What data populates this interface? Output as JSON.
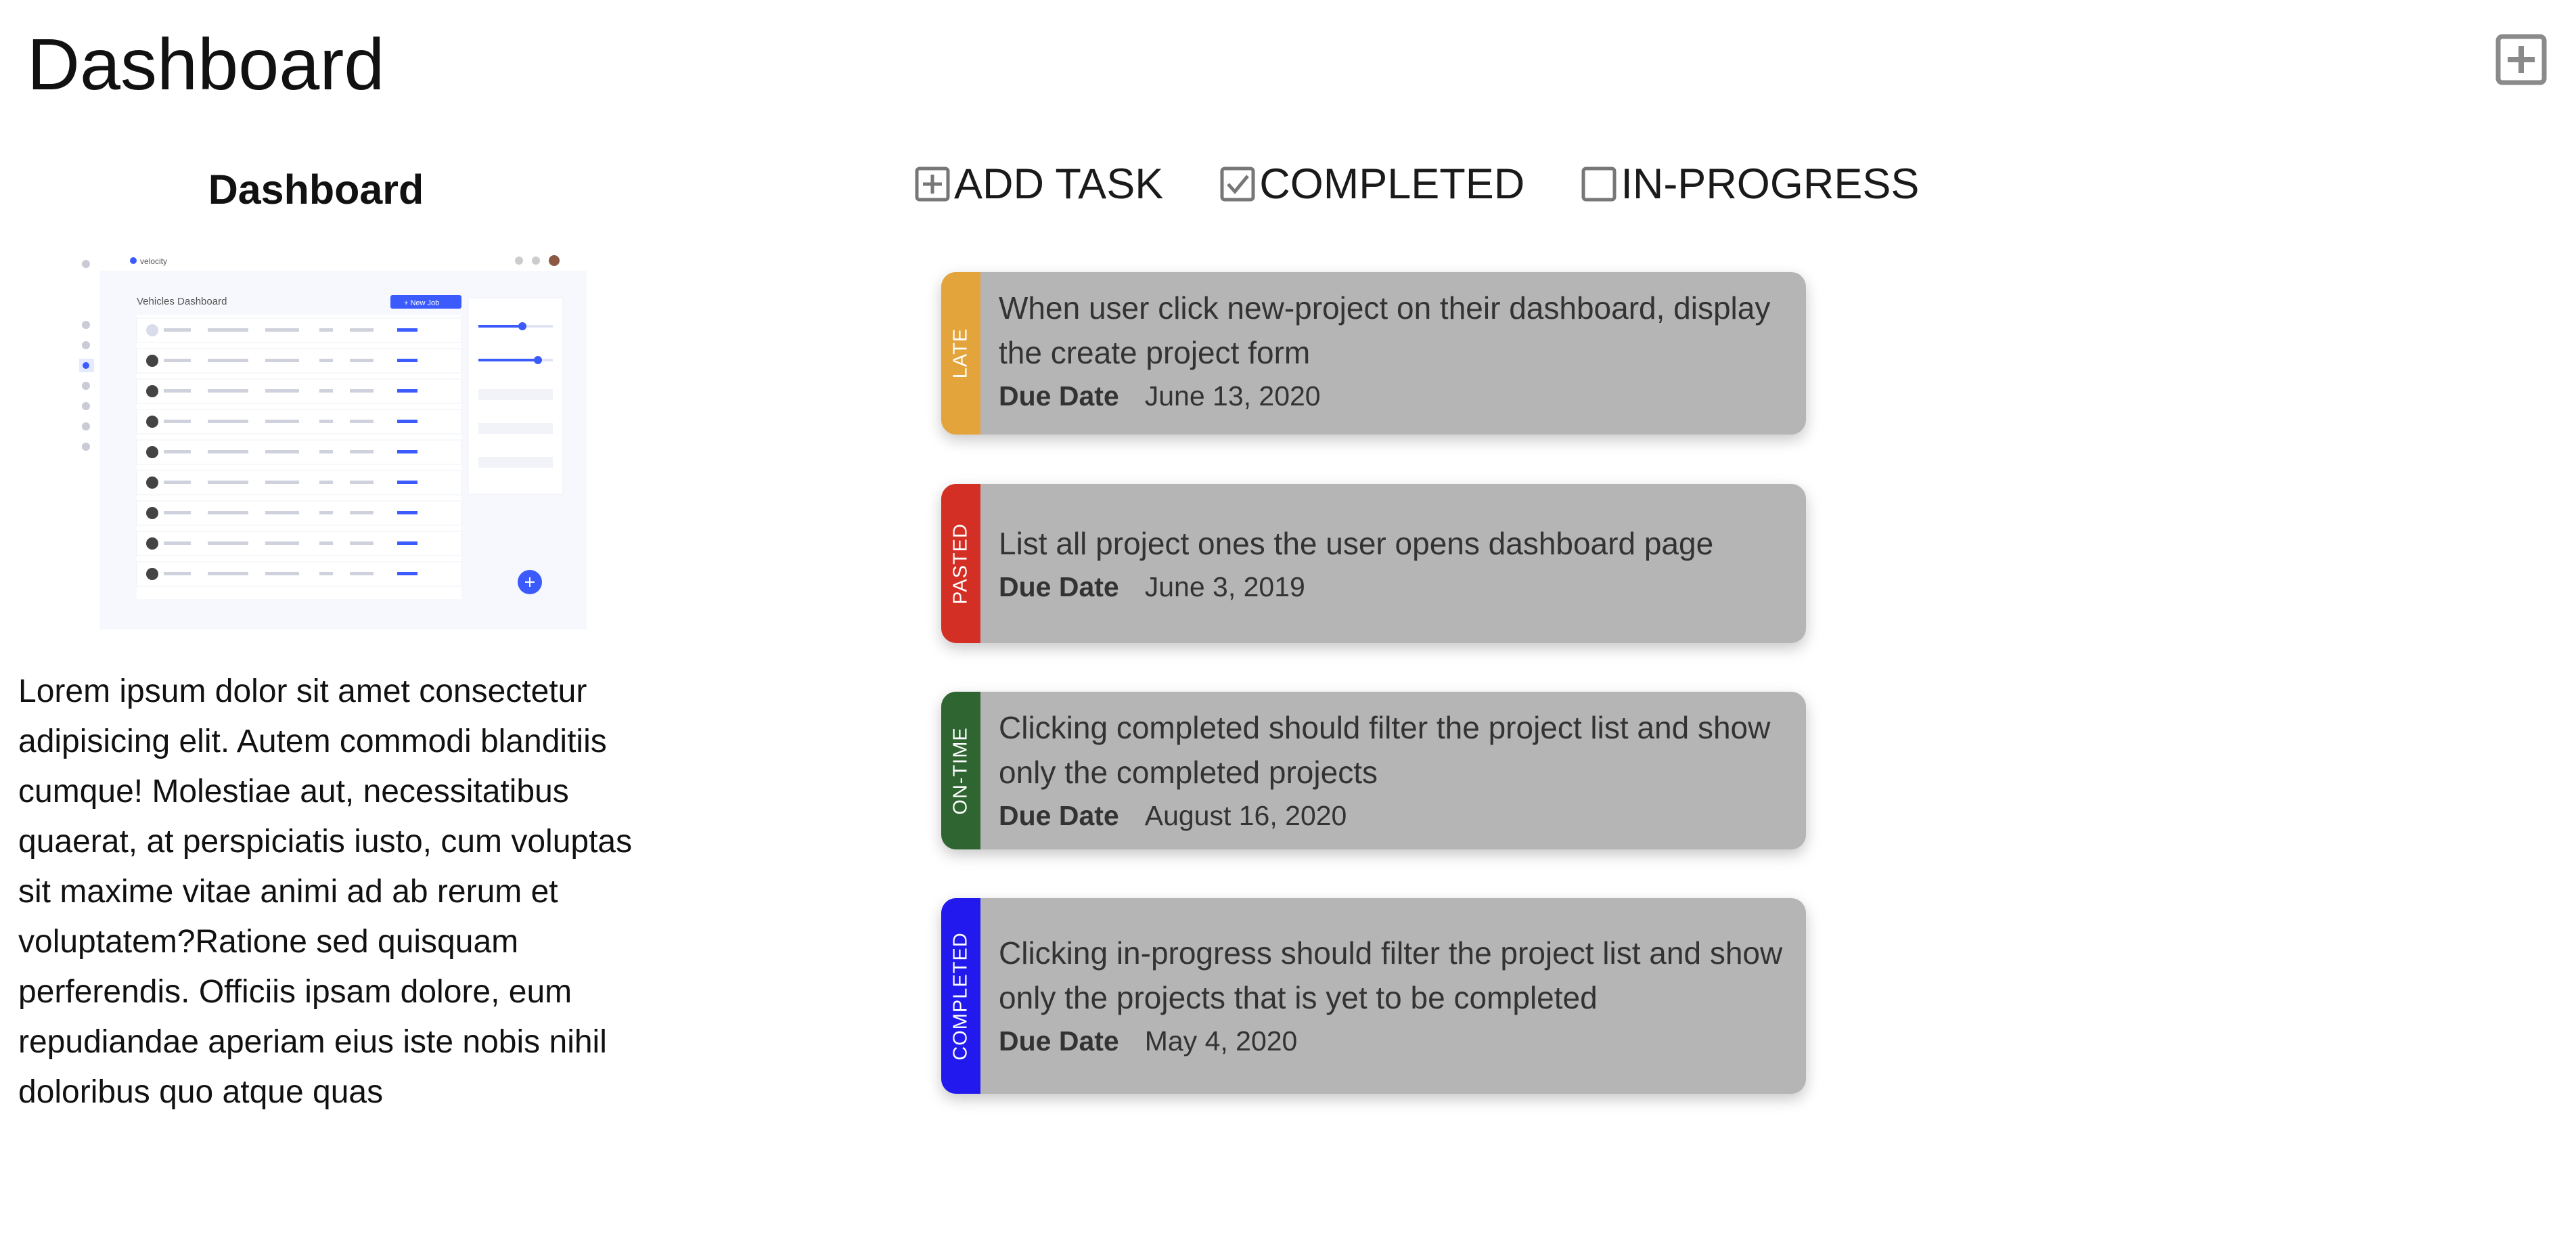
{
  "header": {
    "title": "Dashboard",
    "add_icon": "plus-square-icon"
  },
  "sidebar": {
    "preview_title": "Dashboard",
    "preview_image": {
      "app_name": "velocity",
      "heading": "Vehicles Dashboard",
      "button_label": "+ New Job",
      "accent": "#3b5bfd"
    },
    "body_text": "Lorem ipsum dolor sit amet consectetur adipisicing elit. Autem commodi blanditiis cumque! Molestiae aut, necessitatibus quaerat, at perspiciatis iusto, cum voluptas sit maxime vitae animi ad ab rerum et voluptatem?Ratione sed quisquam perferendis. Officiis ipsam dolore, eum repudiandae aperiam eius iste nobis nihil doloribus quo atque quas"
  },
  "filters": [
    {
      "label": "ADD TASK",
      "icon": "plus-square-icon"
    },
    {
      "label": "COMPLETED",
      "icon": "checked-box-icon"
    },
    {
      "label": "IN-PROGRESS",
      "icon": "empty-box-icon"
    }
  ],
  "tasks": [
    {
      "status": "LATE",
      "color": "#e4a43c",
      "description": "When user click new-project on their dashboard, display the create project form",
      "due_label": "Due Date",
      "due_date": "June 13, 2020"
    },
    {
      "status": "PASTED",
      "color": "#d42f25",
      "description": "List all project ones the user opens dashboard page",
      "due_label": "Due Date",
      "due_date": "June 3, 2019"
    },
    {
      "status": "ON-TIME",
      "color": "#2e6530",
      "description": "Clicking completed should filter the project list and show only the completed projects",
      "due_label": "Due Date",
      "due_date": "August 16, 2020"
    },
    {
      "status": "COMPLETED",
      "color": "#2119ee",
      "description": "Clicking in-progress should filter the project list and show only the projects that is yet to be completed",
      "due_label": "Due Date",
      "due_date": "May 4, 2020"
    }
  ]
}
